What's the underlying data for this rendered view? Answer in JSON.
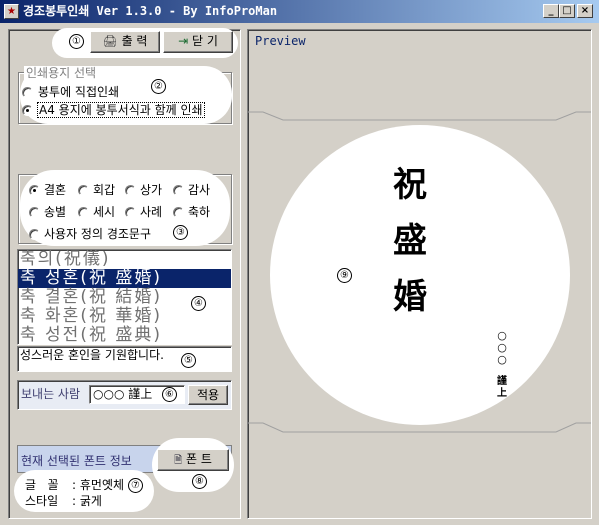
{
  "window": {
    "title": "경조봉투인쇄 Ver 1.3.0 - By InfoProMan",
    "minimize_glyph": "_",
    "maximize_glyph": "□",
    "close_glyph": "×"
  },
  "toolbar": {
    "print_label": "출 력",
    "close_label": "닫 기",
    "marker": "①"
  },
  "paper": {
    "legend": "인쇄용지 선택",
    "marker": "②",
    "options": [
      {
        "label": "봉투에 직접인쇄",
        "selected": false
      },
      {
        "label": "A4 용지에 봉투서식과 함께 인쇄",
        "selected": true
      }
    ]
  },
  "occasion": {
    "marker": "③",
    "row1": [
      {
        "label": "결혼",
        "selected": true
      },
      {
        "label": "회갑",
        "selected": false
      },
      {
        "label": "상가",
        "selected": false
      },
      {
        "label": "감사",
        "selected": false
      }
    ],
    "row2": [
      {
        "label": "송별",
        "selected": false
      },
      {
        "label": "세시",
        "selected": false
      },
      {
        "label": "사례",
        "selected": false
      },
      {
        "label": "축하",
        "selected": false
      }
    ],
    "custom_label": "사용자 정의 경조문구"
  },
  "phrases": {
    "marker": "④",
    "items": [
      {
        "label": "축의(祝儀)",
        "selected": false
      },
      {
        "label": "축 성혼(祝 盛婚)",
        "selected": true
      },
      {
        "label": "축 결혼(祝 結婚)",
        "selected": false
      },
      {
        "label": "축 화혼(祝 華婚)",
        "selected": false
      },
      {
        "label": "축 성전(祝 盛典)",
        "selected": false
      }
    ]
  },
  "message": {
    "text": "성스러운 혼인을 기원합니다.",
    "marker": "⑤"
  },
  "sender": {
    "label": "보내는 사람",
    "value": "○○○ 謹上",
    "apply_label": "적용",
    "marker": "⑥"
  },
  "font": {
    "header": "현재 선택된 폰트 정보",
    "button_label": "폰 트",
    "button_icon": "font-icon",
    "marker_info": "⑦",
    "marker_button": "⑧",
    "face_label": "글   꼴",
    "face_value": ": 휴먼옛체",
    "style_label": "스타일",
    "style_value": ": 굵게"
  },
  "preview": {
    "title": "Preview",
    "marker": "⑨",
    "main_chars": [
      "祝",
      "盛",
      "婚"
    ],
    "sender_chars": [
      "○",
      "○",
      "○",
      "謹",
      "上"
    ],
    "colors": {
      "title": "#0a246a",
      "envelope": "#ffffff"
    }
  }
}
